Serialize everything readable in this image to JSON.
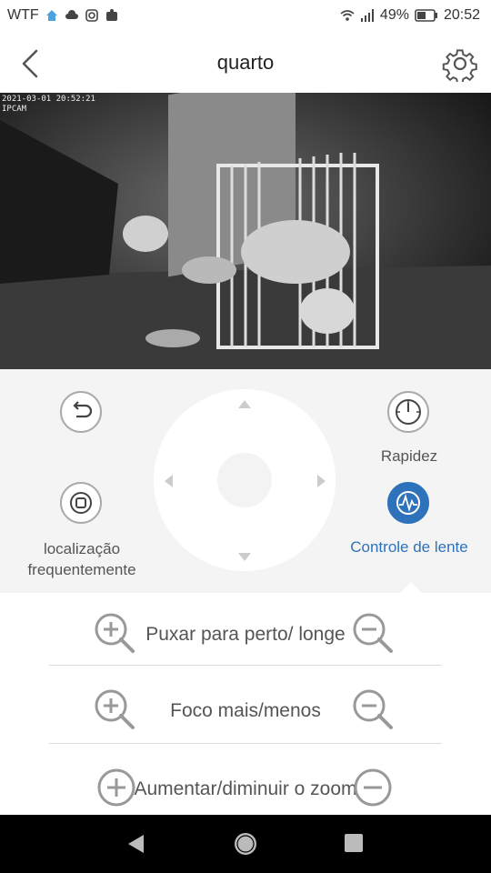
{
  "status_bar": {
    "carrier": "WTF",
    "battery": "49%",
    "time": "20:52",
    "icons_left": [
      "home-icon",
      "cloud-icon",
      "instagram-icon",
      "notification-icon"
    ],
    "icons_right": [
      "wifi-icon",
      "signal-icon",
      "battery-icon"
    ]
  },
  "header": {
    "title": "quarto",
    "back_icon": "chevron-left-icon",
    "settings_icon": "gear-icon"
  },
  "video": {
    "timestamp": "2021-03-01 20:52:21",
    "camera_label": "IPCAM"
  },
  "controls": {
    "undo_icon": "undo-icon",
    "speed_label": "Rapidez",
    "speed_icon": "gauge-icon",
    "frequent_location_label": "localização frequentemente",
    "frequent_location_icon": "target-icon",
    "lens_control_label": "Controle de lente",
    "lens_control_icon": "lens-icon"
  },
  "lens_panel": {
    "rows": [
      {
        "label": "Puxar para perto/ longe",
        "plus_icon": "zoom-in-icon",
        "minus_icon": "zoom-out-icon"
      },
      {
        "label": "Foco mais/menos",
        "plus_icon": "zoom-in-icon",
        "minus_icon": "zoom-out-icon"
      },
      {
        "label": "Aumentar/diminuir o zoom",
        "plus_icon": "plus-circle-icon",
        "minus_icon": "minus-circle-icon"
      }
    ]
  },
  "colors": {
    "accent": "#2d72bb",
    "panel_bg": "#f4f4f4",
    "icon_gray": "#aaaaaa"
  }
}
